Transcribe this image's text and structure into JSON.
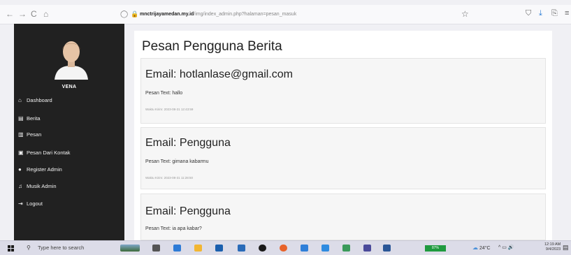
{
  "browser": {
    "back_glyph": "←",
    "forward_glyph": "→",
    "reload_glyph": "C",
    "home_glyph": "⌂",
    "shield_glyph": "◯",
    "lock_glyph": "🔒",
    "url_host": "mnctrijayamedan.my.id",
    "url_path": "/img/index_admin.php?halaman=pesan_masuk",
    "star_glyph": "☆",
    "pocket_glyph": "⛉",
    "download_glyph": "⤓",
    "extensions_glyph": "⎘",
    "menu_glyph": "≡"
  },
  "sidebar": {
    "username": "VENA",
    "items": [
      {
        "icon": "home-icon",
        "glyph": "⌂",
        "label": "Dashboard"
      },
      {
        "icon": "newspaper-icon",
        "glyph": "▤",
        "label": "Berita"
      },
      {
        "icon": "message-icon",
        "glyph": "▥",
        "label": "Pesan"
      },
      {
        "icon": "contact-card-icon",
        "glyph": "▣",
        "label": "Pesan Dari Kontak"
      },
      {
        "icon": "user-plus-icon",
        "glyph": "●",
        "label": "Register Admin"
      },
      {
        "icon": "music-icon",
        "glyph": "♫",
        "label": "Musik Admin"
      },
      {
        "icon": "logout-icon",
        "glyph": "⇥",
        "label": "Logout"
      }
    ]
  },
  "main": {
    "title": "Pesan Pengguna Berita",
    "messages": [
      {
        "email": "Email: hotlanlase@gmail.com",
        "text": "Pesan Text: hallo",
        "time": "Waktu Kirim: 2023-08-31 12:43:59"
      },
      {
        "email": "Email: Pengguna",
        "text": "Pesan Text: gimana kabarmu",
        "time": "Waktu Kirim: 2023-08-31 11:28:50"
      },
      {
        "email": "Email: Pengguna",
        "text": "Pesan Text: ia apa kabar?",
        "time": ""
      }
    ]
  },
  "taskbar": {
    "search_glyph": "⚲",
    "search_placeholder": "Type here to search",
    "battery": "87%",
    "weather_glyph": "☁",
    "weather": "24°C",
    "systray": "^ ▭ 🔊",
    "time": "12:19 AM",
    "date": "9/4/2023",
    "notification_glyph": "▤",
    "colors": {
      "windows": "#1a1a1a",
      "battery": "#1f9a3f"
    }
  }
}
